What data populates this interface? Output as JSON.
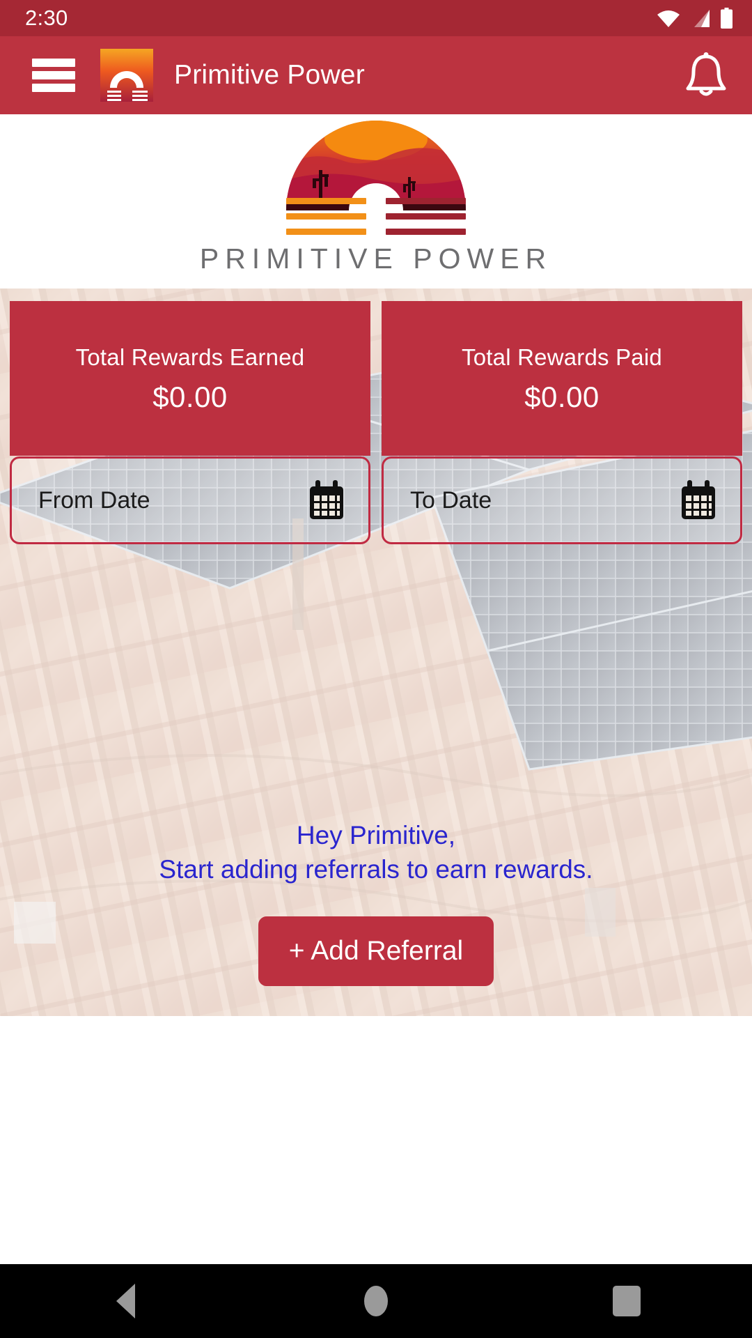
{
  "status_bar": {
    "time": "2:30",
    "icons": [
      "wifi-icon",
      "cellular-signal-icon",
      "battery-icon"
    ]
  },
  "app_bar": {
    "menu_icon": "hamburger-menu-icon",
    "logo_icon": "primitive-power-logo-icon",
    "title": "Primitive Power",
    "notification_icon": "bell-icon"
  },
  "brand": {
    "wordmark": "PRIMITIVE POWER",
    "logo_alt": "primitive-power-sunset-arch-logo",
    "colors": {
      "primary_red": "#BC3040",
      "dark_red": "#A52834",
      "accent_orange": "#F29018",
      "deep_red": "#9E2330",
      "link_blue": "#2A25CE"
    }
  },
  "stats": [
    {
      "label": "Total Rewards Earned",
      "value": "$0.00"
    },
    {
      "label": "Total Rewards Paid",
      "value": "$0.00"
    }
  ],
  "filters": {
    "from_date": {
      "placeholder": "From Date",
      "value": "",
      "icon": "calendar-icon"
    },
    "to_date": {
      "placeholder": "To Date",
      "value": "",
      "icon": "calendar-icon"
    }
  },
  "empty_state": {
    "greeting": "Hey Primitive,",
    "message": "Start adding referrals to earn rewards.",
    "button_label": "+ Add Referral"
  },
  "nav_bar": {
    "back_label": "Back",
    "home_label": "Home",
    "recents_label": "Recents"
  }
}
